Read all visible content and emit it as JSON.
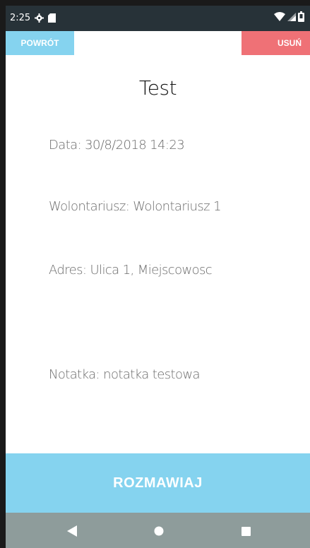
{
  "status_bar": {
    "time": "2:25",
    "icons": [
      "gear-icon",
      "sd-card-icon",
      "wifi-icon",
      "signal-icon",
      "battery-icon"
    ]
  },
  "header": {
    "back_label": "POWRÓT",
    "delete_label": "USUŃ"
  },
  "detail": {
    "title": "Test",
    "date": "Data: 30/8/2018 14:23",
    "volunteer": "Wolontariusz: Wolontariusz 1",
    "address": "Adres: Ulica 1, Miejscowosc",
    "note": "Notatka: notatka testowa"
  },
  "action": {
    "talk_label": "ROZMAWIAJ"
  },
  "nav": {
    "icons": [
      "back-triangle-icon",
      "home-circle-icon",
      "recents-square-icon"
    ]
  },
  "colors": {
    "status_bar": "#273238",
    "accent_blue": "#85d3ef",
    "delete_red": "#ef7176",
    "nav_bar": "#8e9c9b"
  }
}
